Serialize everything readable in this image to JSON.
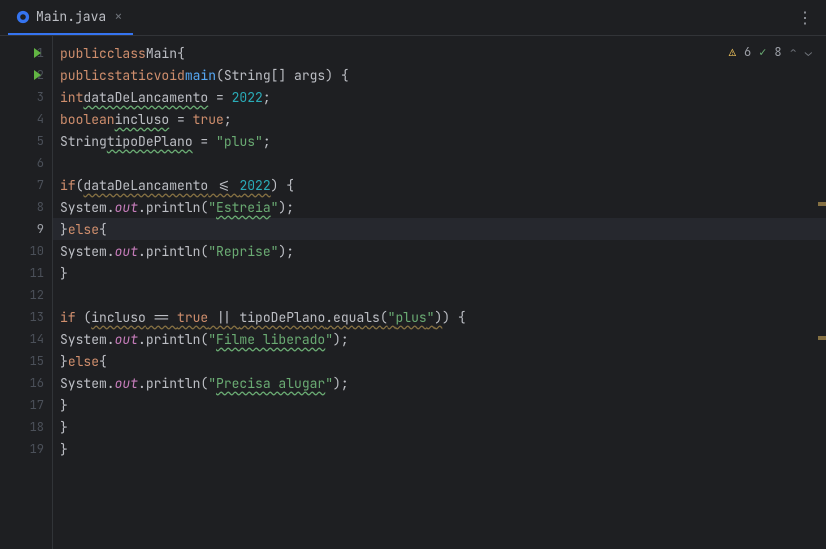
{
  "tab": {
    "name": "Main.java"
  },
  "status": {
    "warnings": "6",
    "checks": "8"
  },
  "lines": [
    "1",
    "2",
    "3",
    "4",
    "5",
    "6",
    "7",
    "8",
    "9",
    "10",
    "11",
    "12",
    "13",
    "14",
    "15",
    "16",
    "17",
    "18",
    "19"
  ],
  "code": {
    "l1": {
      "kw1": "public",
      "kw2": "class",
      "cls": "Main",
      "b": "{"
    },
    "l2": {
      "kw1": "public",
      "kw2": "static",
      "kw3": "void",
      "fn": "main",
      "p": "(String[] args) {"
    },
    "l3": {
      "ty": "int",
      "id": "dataDeLancamento",
      "eq": " = ",
      "v": "2022",
      "s": ";"
    },
    "l4": {
      "ty": "boolean",
      "id": "incluso",
      "eq": " = ",
      "v": "true",
      "s": ";"
    },
    "l5": {
      "ty": "String",
      "id": "tipoDePlano",
      "eq": " = ",
      "q1": "\"",
      "v": "plus",
      "q2": "\"",
      "s": ";"
    },
    "l7": {
      "kw": "if",
      "p1": "(",
      "id": "dataDeLancamento",
      "op": " <= ",
      "n": "2022",
      "p2": ") {"
    },
    "l8": {
      "c": "System.",
      "o": "out",
      "m": ".println(",
      "q1": "\"",
      "s": "Estreia",
      "q2": "\"",
      "p2": ");"
    },
    "l9": {
      "b": "}",
      "kw": "else",
      "b2": "{"
    },
    "l10": {
      "c": "System.",
      "o": "out",
      "m": ".println(",
      "q1": "\"",
      "s": "Reprise",
      "q2": "\"",
      "p2": ");"
    },
    "l11": {
      "b": "}"
    },
    "l13": {
      "kw": "if",
      "p1": " (",
      "id1": "incluso",
      "op1": " == ",
      "v": "true",
      "op2": " || ",
      "id2": "tipoDePlano",
      "m": ".equals(",
      "q1": "\"",
      "s": "plus",
      "q2": "\"",
      "p2": ")",
      "p3": ") {"
    },
    "l14": {
      "c": "System.",
      "o": "out",
      "m": ".println(",
      "q1": "\"",
      "s": "Filme liberado",
      "q2": "\"",
      "p2": ");"
    },
    "l15": {
      "b": "}",
      "kw": "else",
      "b2": "{"
    },
    "l16": {
      "c": "System.",
      "o": "out",
      "m": ".println(",
      "q1": "\"",
      "s": "Precisa alugar",
      "q2": "\"",
      "p2": ");"
    },
    "l17": {
      "b": "}"
    },
    "l18": {
      "b": "}"
    },
    "l19": {
      "b": "}"
    }
  }
}
